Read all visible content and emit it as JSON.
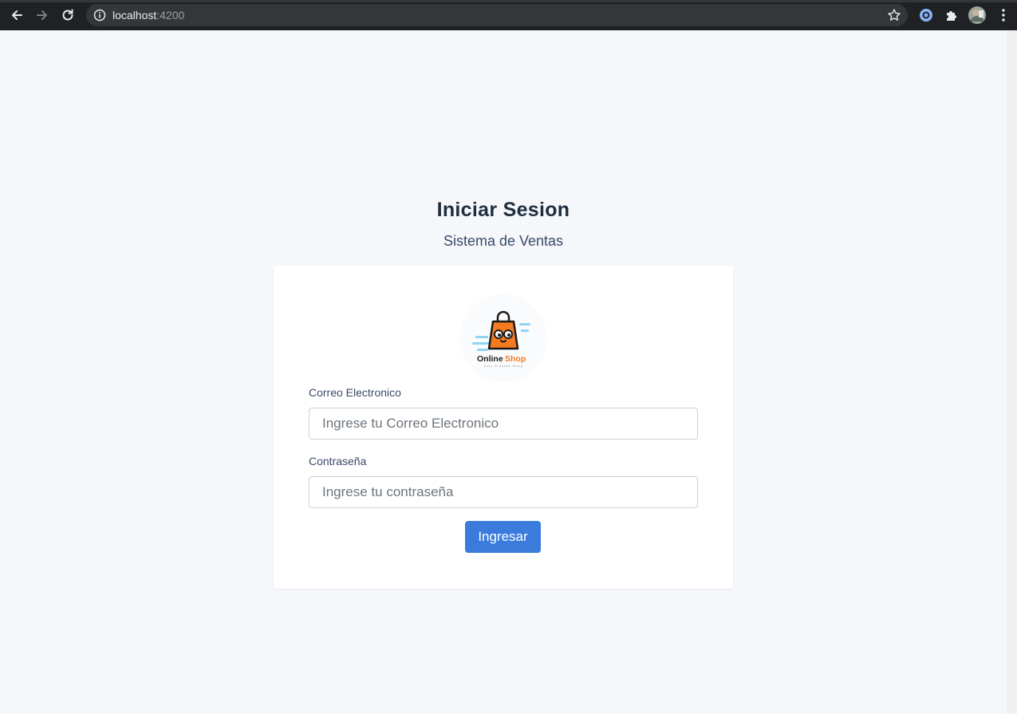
{
  "browser": {
    "url_host": "localhost",
    "url_port": ":4200"
  },
  "page": {
    "title": "Iniciar Sesion",
    "subtitle": "Sistema de Ventas"
  },
  "logo": {
    "name_part1": "Online",
    "name_part2": "Shop",
    "tagline": "Your Trusted Shop",
    "colors": {
      "bag": "#f47b20",
      "outline": "#1b1b1b",
      "speed_lines": "#8fd3f4"
    }
  },
  "form": {
    "email_label": "Correo Electronico",
    "email_placeholder": "Ingrese tu Correo Electronico",
    "email_value": "",
    "password_label": "Contraseña",
    "password_placeholder": "Ingrese tu contraseña",
    "password_value": "",
    "submit_label": "Ingresar"
  },
  "colors": {
    "page_bg": "#f5f7fb",
    "card_bg": "#ffffff",
    "primary": "#3a7bdc",
    "heading": "#1f2d3d",
    "browser_bar": "#202124"
  }
}
